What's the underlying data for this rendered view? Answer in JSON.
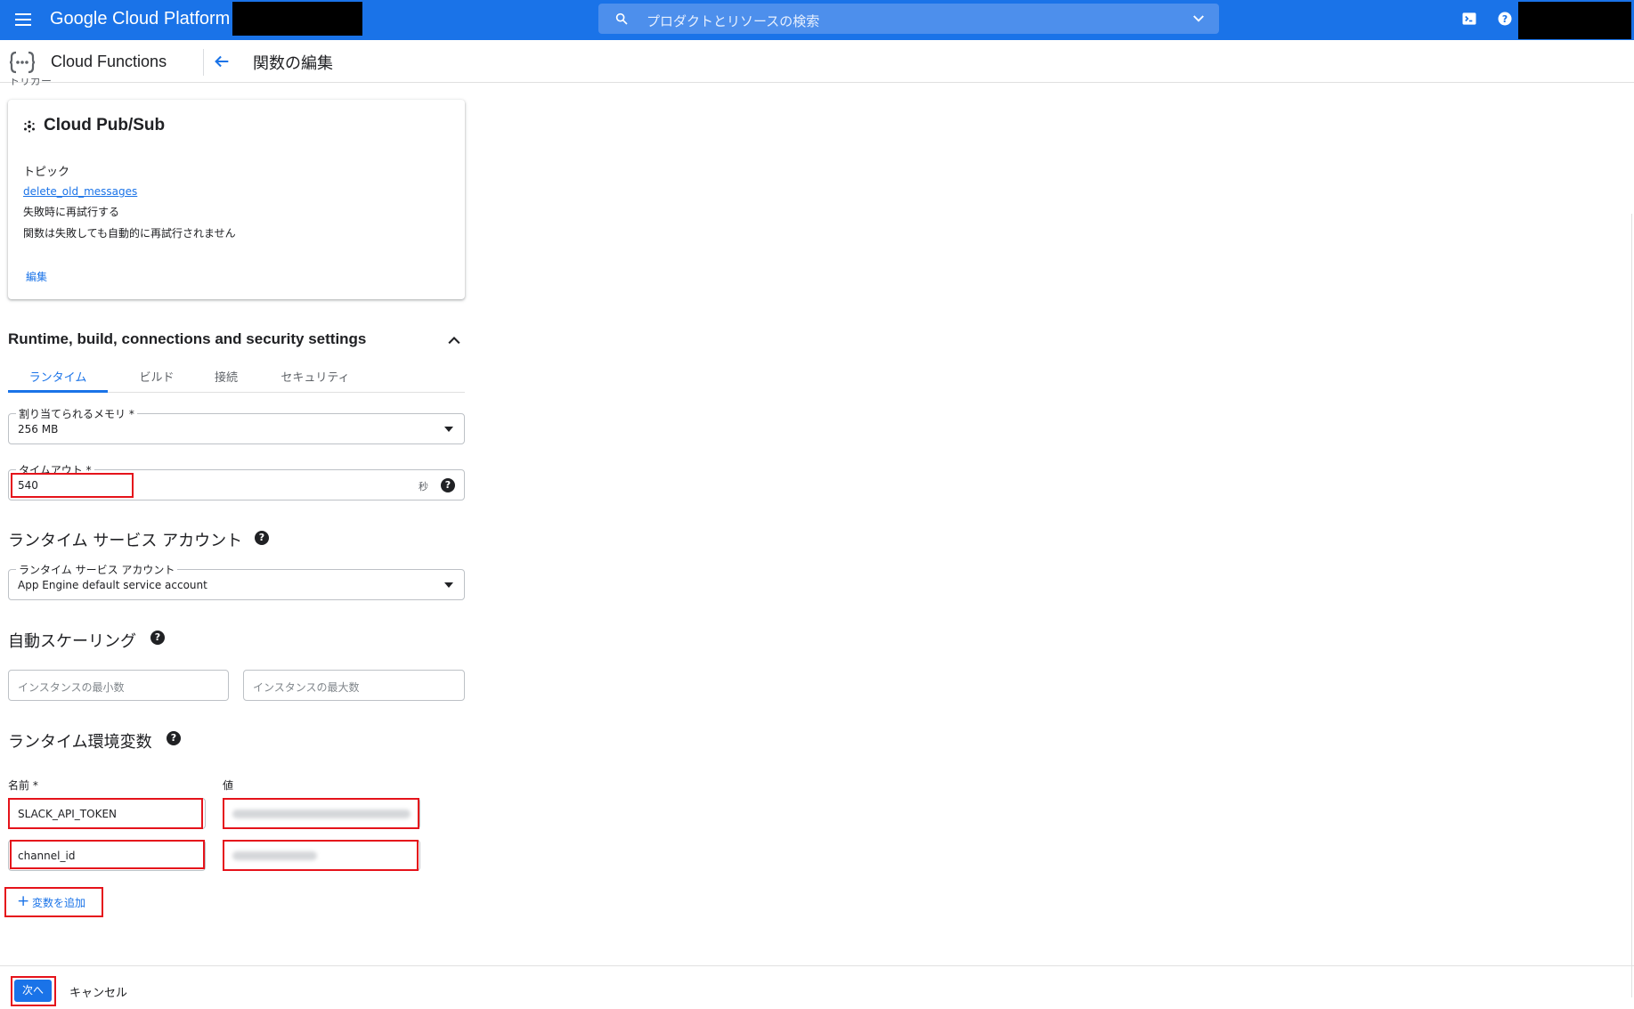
{
  "topbar": {
    "brand": "Google Cloud Platform",
    "search_placeholder": "プロダクトとリソースの検索",
    "bg_color": "#1a73e8"
  },
  "subheader": {
    "product": "Cloud Functions",
    "page_title": "関数の編集"
  },
  "trigger": {
    "section_label_cut": "トリガー",
    "type": "Cloud Pub/Sub",
    "topic_label": "トピック",
    "topic_name": "delete_old_messages",
    "retry_label": "失敗時に再試行する",
    "retry_desc": "関数は失敗しても自動的に再試行されません",
    "edit_label": "編集"
  },
  "settings": {
    "title": "Runtime, build, connections and security settings",
    "tabs": [
      "ランタイム",
      "ビルド",
      "接続",
      "セキュリティ"
    ],
    "memory": {
      "label": "割り当てられるメモリ *",
      "value": "256 MB"
    },
    "timeout": {
      "label": "タイムアウト *",
      "value": "540",
      "unit": "秒"
    },
    "service_account": {
      "section_title": "ランタイム サービス アカウント",
      "label": "ランタイム サービス アカウント",
      "value": "App Engine default service account"
    },
    "autoscaling": {
      "section_title": "自動スケーリング",
      "min_placeholder": "インスタンスの最小数",
      "max_placeholder": "インスタンスの最大数"
    },
    "env": {
      "section_title": "ランタイム環境変数",
      "name_header": "名前 *",
      "value_header": "値",
      "rows": [
        {
          "name": "SLACK_API_TOKEN"
        },
        {
          "name": "channel_id"
        }
      ],
      "add_label": "変数を追加"
    }
  },
  "footer": {
    "next_label": "次へ",
    "cancel_label": "キャンセル"
  },
  "colors": {
    "accent": "#1a73e8",
    "highlight": "#e5131b"
  }
}
